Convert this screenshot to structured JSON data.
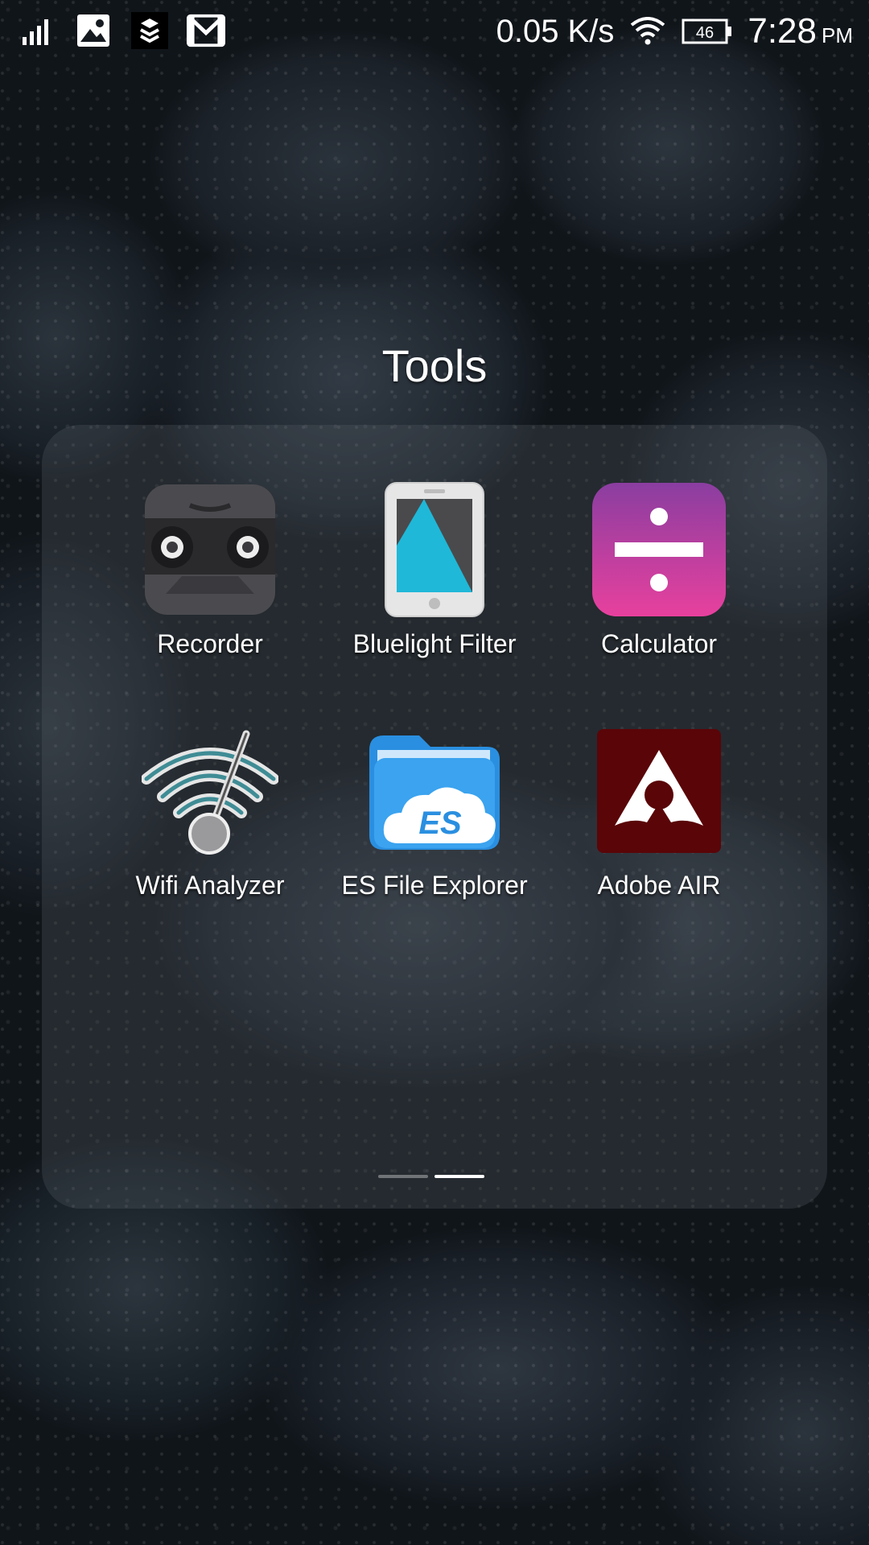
{
  "status_bar": {
    "left_icons": [
      "signal-bars-icon",
      "gallery-notification-icon",
      "layers-app-icon",
      "gmail-icon"
    ],
    "network_speed": "0.05 K/s",
    "battery_level": "46",
    "time": "7:28",
    "ampm": "PM"
  },
  "folder": {
    "title": "Tools",
    "apps": [
      {
        "label": "Recorder",
        "icon": "recorder-icon"
      },
      {
        "label": "Bluelight Filter",
        "icon": "bluelight-filter-icon"
      },
      {
        "label": "Calculator",
        "icon": "calculator-icon"
      },
      {
        "label": "Wifi Analyzer",
        "icon": "wifi-analyzer-icon"
      },
      {
        "label": "ES File Explorer",
        "icon": "es-file-explorer-icon"
      },
      {
        "label": "Adobe AIR",
        "icon": "adobe-air-icon"
      }
    ],
    "page_count": 2,
    "active_page": 2
  },
  "colors": {
    "calculator_top": "#8a3ea0",
    "calculator_bottom": "#e8409e",
    "adobe_air": "#5a0508",
    "es_blue": "#2a8fe0",
    "bluelight_screen": "#1fb8d8"
  }
}
